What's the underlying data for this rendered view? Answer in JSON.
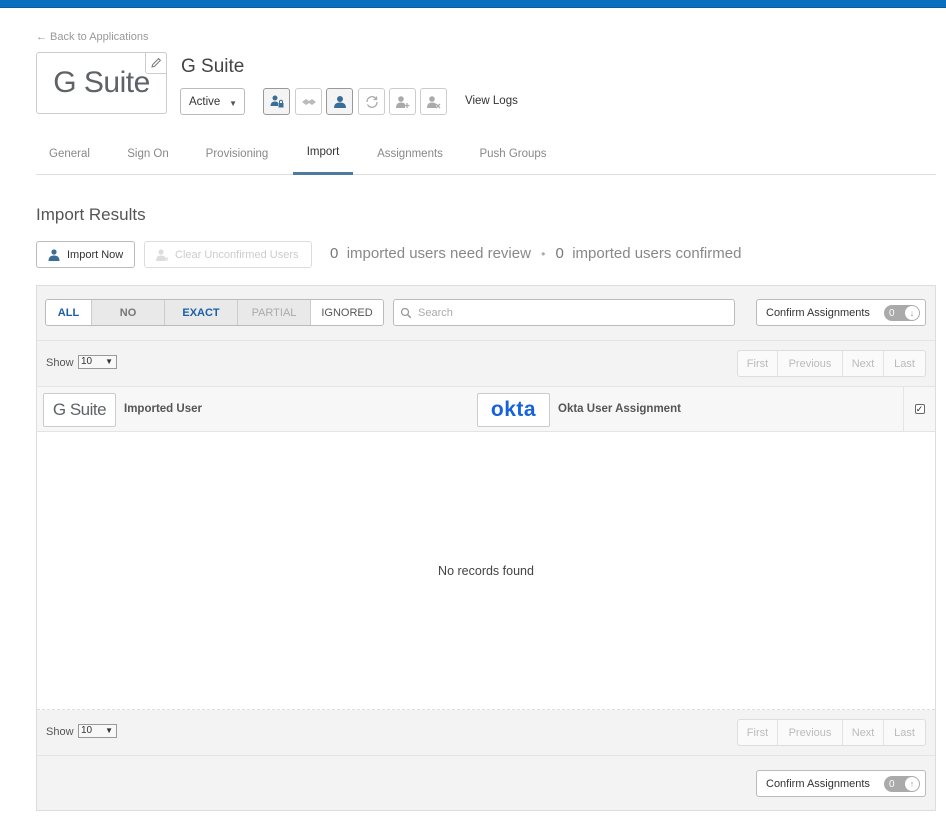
{
  "header": {
    "back_link": "← Back to Applications",
    "app_title": "G Suite",
    "logo_text": "G Suite",
    "status": "Active",
    "view_logs": "View Logs"
  },
  "tabs": [
    {
      "label": "General"
    },
    {
      "label": "Sign On"
    },
    {
      "label": "Provisioning"
    },
    {
      "label": "Import"
    },
    {
      "label": "Assignments"
    },
    {
      "label": "Push Groups"
    }
  ],
  "active_tab": "Import",
  "import": {
    "title": "Import Results",
    "import_now_label": "Import Now",
    "clear_label": "Clear Unconfirmed Users",
    "review_count": "0",
    "review_text": "imported users need review",
    "confirmed_count": "0",
    "confirmed_text": "imported users confirmed"
  },
  "filters": {
    "options": [
      "ALL",
      "NO",
      "EXACT",
      "PARTIAL",
      "IGNORED"
    ],
    "selected": "ALL",
    "search_placeholder": "Search",
    "confirm_label": "Confirm Assignments",
    "confirm_count": "0"
  },
  "pagination": {
    "show_label": "Show",
    "page_size": "10",
    "buttons": [
      "First",
      "Previous",
      "Next",
      "Last"
    ]
  },
  "columns": {
    "left_logo": "G Suite",
    "left_label": "Imported User",
    "right_logo": "okta",
    "right_label": "Okta User Assignment"
  },
  "empty_message": "No records found",
  "colors": {
    "topbar": "#0a6fbf",
    "okta_blue": "#1662dd",
    "active_tab_underline": "#4d7a9e",
    "filter_all": "#1a5fa8",
    "filter_no": "#777777",
    "filter_exact": "#1a5fa8",
    "filter_partial": "#aaaaaa",
    "filter_ignored": "#555555"
  }
}
